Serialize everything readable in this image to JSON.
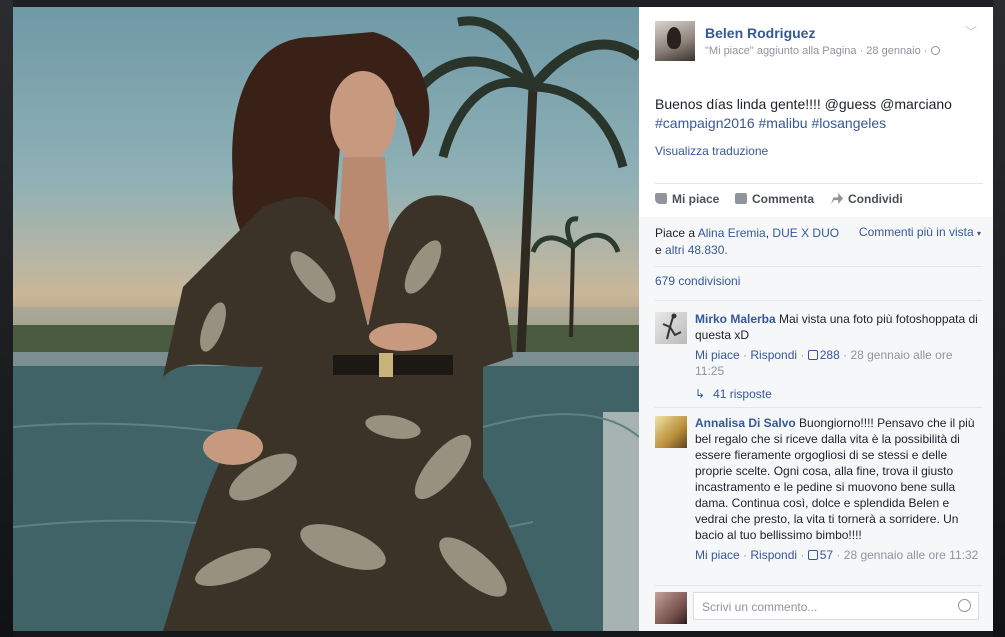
{
  "post": {
    "page_name": "Belen Rodriguez",
    "meta": "\"Mi piace\" aggiunto alla Pagina · 28 gennaio ·",
    "text_plain": "Buenos días linda gente!!!! @guess @marciano",
    "hashtags": "#campaign2016 #malibu #losangeles",
    "translate": "Visualizza traduzione"
  },
  "actions": {
    "like": "Mi piace",
    "comment": "Commenta",
    "share": "Condividi"
  },
  "likes": {
    "prefix": "Piace a",
    "person1": "Alina Eremia",
    "person2": "DUE X DUO",
    "e": "e",
    "others": "altri 48.830.",
    "most_relevant": "Commenti più in vista"
  },
  "shares": "679 condivisioni",
  "comments": [
    {
      "author": "Mirko Malerba",
      "text": "Mai vista una foto più fotoshoppata di questa xD",
      "like": "Mi piace",
      "reply": "Rispondi",
      "count": "288",
      "date": "28 gennaio alle ore 11:25"
    },
    {
      "author": "Annalisa Di Salvo",
      "text": "Buongiorno!!!! Pensavo che il più bel regalo che si riceve dalla vita è la possibilità di essere fieramente orgogliosi di se stessi e delle proprie scelte. Ogni cosa, alla fine, trova il giusto incastramento e le pedine si muovono bene sulla dama. Continua così, dolce e splendida Belen e vedrai che presto, la vita ti tornerà a sorridere. Un bacio al tuo bellissimo bimbo!!!!",
      "like": "Mi piace",
      "reply": "Rispondi",
      "count": "57",
      "date": "28 gennaio alle ore 11:32"
    }
  ],
  "replies": "41 risposte",
  "write_placeholder": "Scrivi un commento...",
  "icons": {
    "chevron": "chevron-down-icon",
    "globe": "globe-icon",
    "like": "thumbs-up-icon",
    "comment": "comment-icon",
    "share": "share-arrow-icon",
    "reply_arrow": "reply-arrow-icon",
    "emoji": "smiley-icon"
  },
  "colors": {
    "link": "#365899",
    "muted": "#90949c",
    "panel_bg": "#f6f7f9"
  }
}
